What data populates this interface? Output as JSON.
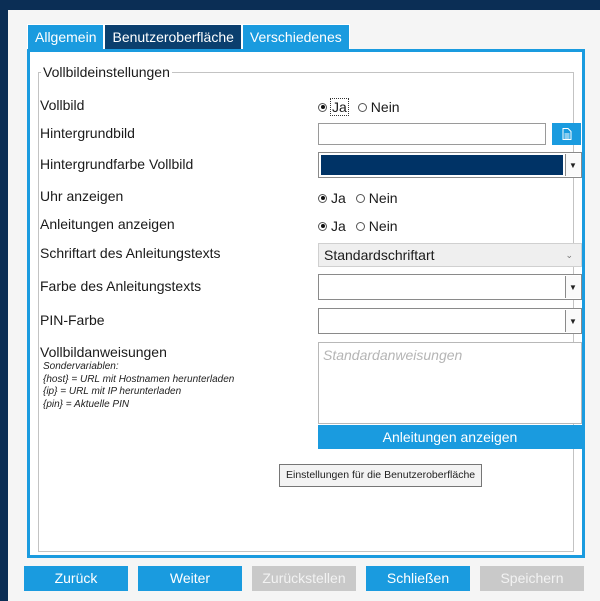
{
  "tabs": [
    {
      "label": "Allgemein",
      "active": false
    },
    {
      "label": "Benutzeroberfläche",
      "active": true
    },
    {
      "label": "Verschiedenes",
      "active": false
    }
  ],
  "section": {
    "legend": "Vollbildeinstellungen"
  },
  "radio": {
    "yes": "Ja",
    "no": "Nein"
  },
  "fields": {
    "vollbild": {
      "label": "Vollbild",
      "value": "Ja"
    },
    "hintergrundbild": {
      "label": "Hintergrundbild",
      "value": "",
      "browse_icon": "document-icon"
    },
    "hintergrundfarbe": {
      "label": "Hintergrundfarbe Vollbild",
      "color": "#003366"
    },
    "uhr": {
      "label": "Uhr anzeigen",
      "value": "Ja"
    },
    "anleitungen": {
      "label": "Anleitungen anzeigen",
      "value": "Ja"
    },
    "schriftart": {
      "label": "Schriftart des Anleitungstexts",
      "value": "Standardschriftart"
    },
    "farbe_text": {
      "label": "Farbe des Anleitungstexts",
      "color": "#ffffff"
    },
    "pin_farbe": {
      "label": "PIN-Farbe",
      "color": "#ffffff"
    },
    "anweisungen": {
      "label": "Vollbildanweisungen",
      "placeholder": "Standardanweisungen",
      "sub_lines": [
        "Sondervariablen:",
        "{host} = URL mit Hostnamen herunterladen",
        "{ip} = URL mit IP herunterladen",
        "{pin} = Aktuelle PIN"
      ]
    }
  },
  "show_button": "Anleitungen anzeigen",
  "tooltip": "Einstellungen für die Benutzeroberfläche",
  "bottom_buttons": [
    {
      "label": "Zurück",
      "enabled": true
    },
    {
      "label": "Weiter",
      "enabled": true
    },
    {
      "label": "Zurückstellen",
      "enabled": false
    },
    {
      "label": "Schließen",
      "enabled": true
    },
    {
      "label": "Speichern",
      "enabled": false
    }
  ],
  "colors": {
    "accent": "#1a9bdf",
    "active_tab": "#0b3f6e",
    "frame": "#0b2e55"
  }
}
